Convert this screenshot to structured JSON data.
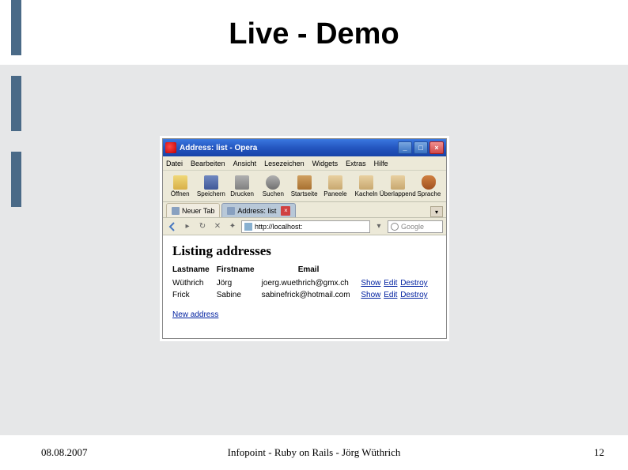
{
  "slide": {
    "title": "Live - Demo",
    "date": "08.08.2007",
    "footer_center": "Infopoint - Ruby on Rails - Jörg Wüthrich",
    "page_number": "12"
  },
  "browser": {
    "window_title": "Address: list - Opera",
    "menu": {
      "file": "Datei",
      "edit": "Bearbeiten",
      "view": "Ansicht",
      "bookmarks": "Lesezeichen",
      "widgets": "Widgets",
      "extras": "Extras",
      "help": "Hilfe"
    },
    "toolbar": {
      "open": "Öffnen",
      "save": "Speichern",
      "print": "Drucken",
      "search": "Suchen",
      "home": "Startseite",
      "panels": "Paneele",
      "tile": "Kacheln",
      "overlap": "Überlappend",
      "voice": "Sprache"
    },
    "tabs": {
      "new_tab": "Neuer Tab",
      "active": "Address: list"
    },
    "address_bar": "http://localhost:",
    "search_placeholder": "Google"
  },
  "page": {
    "heading": "Listing addresses",
    "columns": {
      "lastname": "Lastname",
      "firstname": "Firstname",
      "email": "Email"
    },
    "rows": [
      {
        "lastname": "Wüthrich",
        "firstname": "Jörg",
        "email": "joerg.wuethrich@gmx.ch"
      },
      {
        "lastname": "Frick",
        "firstname": "Sabine",
        "email": "sabinefrick@hotmail.com"
      }
    ],
    "actions": {
      "show": "Show",
      "edit": "Edit",
      "destroy": "Destroy"
    },
    "new_link": "New address"
  }
}
